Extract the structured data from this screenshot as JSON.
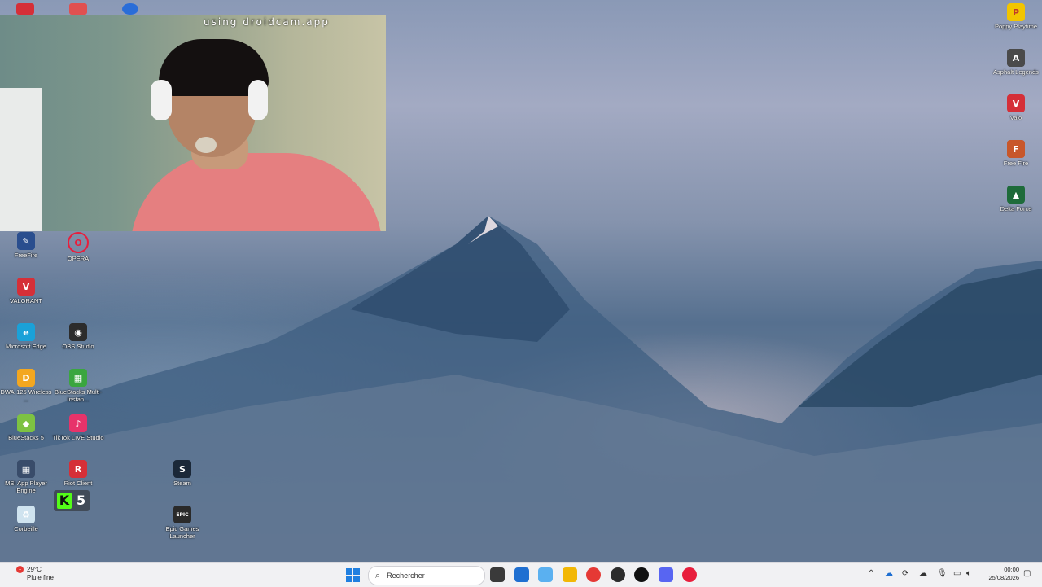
{
  "webcam": {
    "caption": "using droidcam.app"
  },
  "desktop_left": [
    {
      "label": "FreeFire",
      "icon": "freefire-icon",
      "color": "#2a4e8e",
      "glyph": "✎"
    },
    {
      "label": "OPERA",
      "icon": "opera-icon",
      "color": "transparent",
      "glyph": "O"
    },
    {
      "label": "VALORANT",
      "icon": "valorant-icon",
      "color": "#d52f38",
      "glyph": "V"
    },
    {
      "label": "Microsoft Edge",
      "icon": "edge-icon",
      "color": "#1aa1d8",
      "glyph": "e"
    },
    {
      "label": "OBS Studio",
      "icon": "obs-icon",
      "color": "#2c2c2c",
      "glyph": "◉"
    },
    {
      "label": "DWA-125 Wireless ...",
      "icon": "dlink-icon",
      "color": "#f3a720",
      "glyph": "D"
    },
    {
      "label": "BlueStacks Multi-Instan...",
      "icon": "bluestacks-multi-icon",
      "color": "#3aa63f",
      "glyph": "▦"
    },
    {
      "label": "BlueStacks 5",
      "icon": "bluestacks-icon",
      "color": "#7dc242",
      "glyph": "◆"
    },
    {
      "label": "TikTok LIVE Studio",
      "icon": "tiktok-live-icon",
      "color": "#e7336a",
      "glyph": "♪"
    },
    {
      "label": "Steam",
      "icon": "steam-icon",
      "color": "#1b2838",
      "glyph": "S"
    },
    {
      "label": "MSI App Player Engine",
      "icon": "msi-icon",
      "color": "#394c6a",
      "glyph": "▦"
    },
    {
      "label": "Riot Client",
      "icon": "riot-icon",
      "color": "#d52f38",
      "glyph": "R"
    },
    {
      "label": "Corbeille",
      "icon": "recycle-bin-icon",
      "color": "#cfe3ef",
      "glyph": "♻"
    },
    {
      "label": "Epic Games Launcher",
      "icon": "epic-games-icon",
      "color": "#2a2a2a",
      "glyph": "EPIC"
    }
  ],
  "kick_widget": {
    "glyph": "K",
    "number": "5"
  },
  "desktop_right": [
    {
      "label": "Poppy Playtime",
      "icon": "poppy-playtime-icon",
      "color": "#f2c500",
      "glyph": "P"
    },
    {
      "label": "Asphalt Legends",
      "icon": "asphalt-icon",
      "color": "#4a4a4a",
      "glyph": "A"
    },
    {
      "label": "Valo",
      "icon": "valo-icon",
      "color": "#d52f38",
      "glyph": "V"
    },
    {
      "label": "Free Fire",
      "icon": "free-fire-icon",
      "color": "#c8572a",
      "glyph": "F"
    },
    {
      "label": "Delta Force",
      "icon": "delta-force-icon",
      "color": "#1e6b3a",
      "glyph": "▲"
    }
  ],
  "taskbar": {
    "weather_temp": "29°C",
    "weather_desc": "Pluie fine",
    "weather_badge": "1",
    "search_placeholder": "Rechercher",
    "apps": [
      {
        "name": "task-view-icon",
        "color": "#3a3a3a"
      },
      {
        "name": "store-icon",
        "color": "#1f6fd1"
      },
      {
        "name": "copilot-icon",
        "color": "#5ab0f0"
      },
      {
        "name": "file-explorer-icon",
        "color": "#f2b705"
      },
      {
        "name": "chrome-icon",
        "color": "#e53935"
      },
      {
        "name": "obs-icon",
        "color": "#2c2c2c"
      },
      {
        "name": "wacom-icon",
        "color": "#111111"
      },
      {
        "name": "discord-icon",
        "color": "#5865f2"
      },
      {
        "name": "opera-icon",
        "color": "#e81e3c"
      }
    ],
    "clock_time": "00:00",
    "clock_date": "25/08/2026"
  }
}
